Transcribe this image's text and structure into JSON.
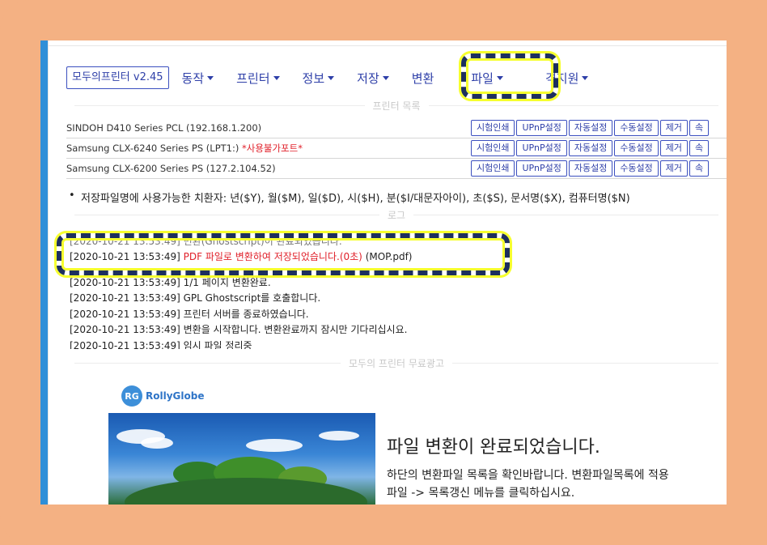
{
  "nav": {
    "brand": "모두의프린터 v2.45",
    "menus": [
      {
        "label": "동작"
      },
      {
        "label": "프린터"
      },
      {
        "label": "정보"
      },
      {
        "label": "저장"
      },
      {
        "label": "변환"
      },
      {
        "label": "파일"
      },
      {
        "label": "격지원"
      }
    ]
  },
  "printers": {
    "title": "프린터 목록",
    "rows": [
      {
        "name": "SINDOH D410 Series PCL (192.168.1.200)",
        "warning": ""
      },
      {
        "name": "Samsung CLX-6240 Series PS (LPT1:) ",
        "warning": "*사용불가포트*"
      },
      {
        "name": "Samsung CLX-6200 Series PS (127.2.104.52)",
        "warning": ""
      }
    ],
    "buttons": [
      "시험인쇄",
      "UPnP설정",
      "자동설정",
      "수동설정",
      "제거",
      "속"
    ]
  },
  "hint": "저장파일명에 사용가능한 치환자: 년($Y), 월($M), 일($D), 시($H), 분($I/대문자아이), 초($S), 문서명($X), 컴퓨터명($N)",
  "log": {
    "title": "로그",
    "lines": [
      {
        "ts": "[2020-10-21 13:53:49]",
        "red": "",
        "text": " 변환(Ghostscript)이 완료되었습니다."
      },
      {
        "ts": "[2020-10-21 13:53:49]",
        "red": " PDF 파일로 변환하여 저장되었습니다.(0초)",
        "text": " (MOP.pdf)"
      },
      {
        "ts": "[2020-10-21 13:53:49]",
        "red": "",
        "text": " 1/1 페이지 변환완료."
      },
      {
        "ts": "[2020-10-21 13:53:49]",
        "red": "",
        "text": " GPL Ghostscript를 호출합니다."
      },
      {
        "ts": "[2020-10-21 13:53:49]",
        "red": "",
        "text": " 프린터 서버를 종료하였습니다."
      },
      {
        "ts": "[2020-10-21 13:53:49]",
        "red": "",
        "text": " 변환을 시작합니다. 변환완료까지 잠시만 기다리십시요."
      },
      {
        "ts": "[2020-10-21 13:53:49]",
        "red": "",
        "text": " 임시 파일 정리중"
      }
    ]
  },
  "ad": {
    "title": "모두의 프린터 무료광고",
    "logo_mark": "RG",
    "logo_text": "RollyGlobe",
    "heading": "파일 변환이 완료되었습니다.",
    "desc1": "하단의 변환파일 목록을 확인바랍니다. 변환파일목록에 적용",
    "desc2": "파일 -> 목록갱신 메뉴를 클릭하십시요."
  },
  "colors": {
    "background": "#f4b183",
    "accent": "#2e3fa8",
    "warning": "#e0202a",
    "highlight": "#f6ff2e",
    "highlight_border": "#1d2f5e"
  }
}
